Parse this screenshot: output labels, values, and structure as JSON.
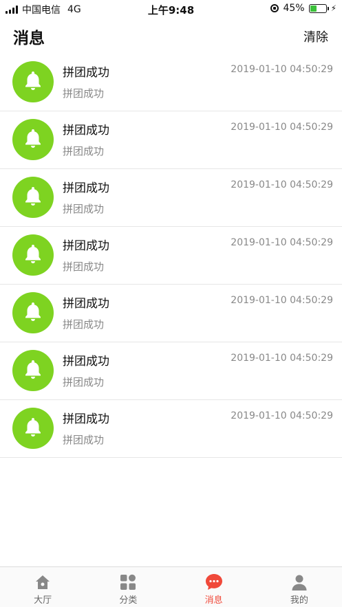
{
  "status_bar": {
    "carrier": "中国电信",
    "network": "4G",
    "time": "上午9:48",
    "battery_percent_label": "45%",
    "battery_level": 0.45
  },
  "header": {
    "title": "消息",
    "clear_label": "清除"
  },
  "messages": [
    {
      "title": "拼团成功",
      "body": "拼团成功",
      "time": "2019-01-10 04:50:29",
      "icon": "bell-icon"
    },
    {
      "title": "拼团成功",
      "body": "拼团成功",
      "time": "2019-01-10 04:50:29",
      "icon": "bell-icon"
    },
    {
      "title": "拼团成功",
      "body": "拼团成功",
      "time": "2019-01-10 04:50:29",
      "icon": "bell-icon"
    },
    {
      "title": "拼团成功",
      "body": "拼团成功",
      "time": "2019-01-10 04:50:29",
      "icon": "bell-icon"
    },
    {
      "title": "拼团成功",
      "body": "拼团成功",
      "time": "2019-01-10 04:50:29",
      "icon": "bell-icon"
    },
    {
      "title": "拼团成功",
      "body": "拼团成功",
      "time": "2019-01-10 04:50:29",
      "icon": "bell-icon"
    },
    {
      "title": "拼团成功",
      "body": "拼团成功",
      "time": "2019-01-10 04:50:29",
      "icon": "bell-icon"
    }
  ],
  "tabbar": {
    "items": [
      {
        "label": "大厅",
        "icon": "home-icon",
        "active": false
      },
      {
        "label": "分类",
        "icon": "grid-icon",
        "active": false
      },
      {
        "label": "消息",
        "icon": "chat-bubble-icon",
        "active": true
      },
      {
        "label": "我的",
        "icon": "person-icon",
        "active": false
      }
    ]
  },
  "colors": {
    "avatar_green": "#7ed321",
    "active_tab": "#f0493a",
    "battery_green": "#3cc13b"
  }
}
